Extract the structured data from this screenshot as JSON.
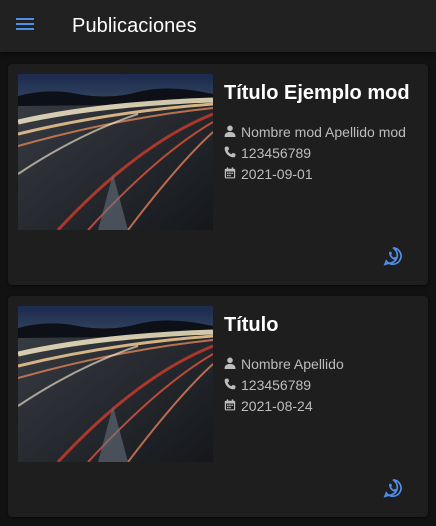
{
  "appbar": {
    "title": "Publicaciones",
    "menu_icon": "menu-icon",
    "accent": "#4f8ee8"
  },
  "posts": [
    {
      "title": "Título Ejemplo mod",
      "name": "Nombre mod Apellido mod",
      "phone": "123456789",
      "date": "2021-09-01",
      "image": "highway-light-trails-photo",
      "action_icon": "whatsapp-icon"
    },
    {
      "title": "Título",
      "name": "Nombre Apellido",
      "phone": "123456789",
      "date": "2021-08-24",
      "image": "highway-light-trails-photo",
      "action_icon": "whatsapp-icon"
    }
  ],
  "colors": {
    "background": "#121212",
    "appbar": "#212121",
    "card": "#1e1e1e",
    "accent": "#4f8ee8",
    "meta_text": "#bdbdbd"
  }
}
